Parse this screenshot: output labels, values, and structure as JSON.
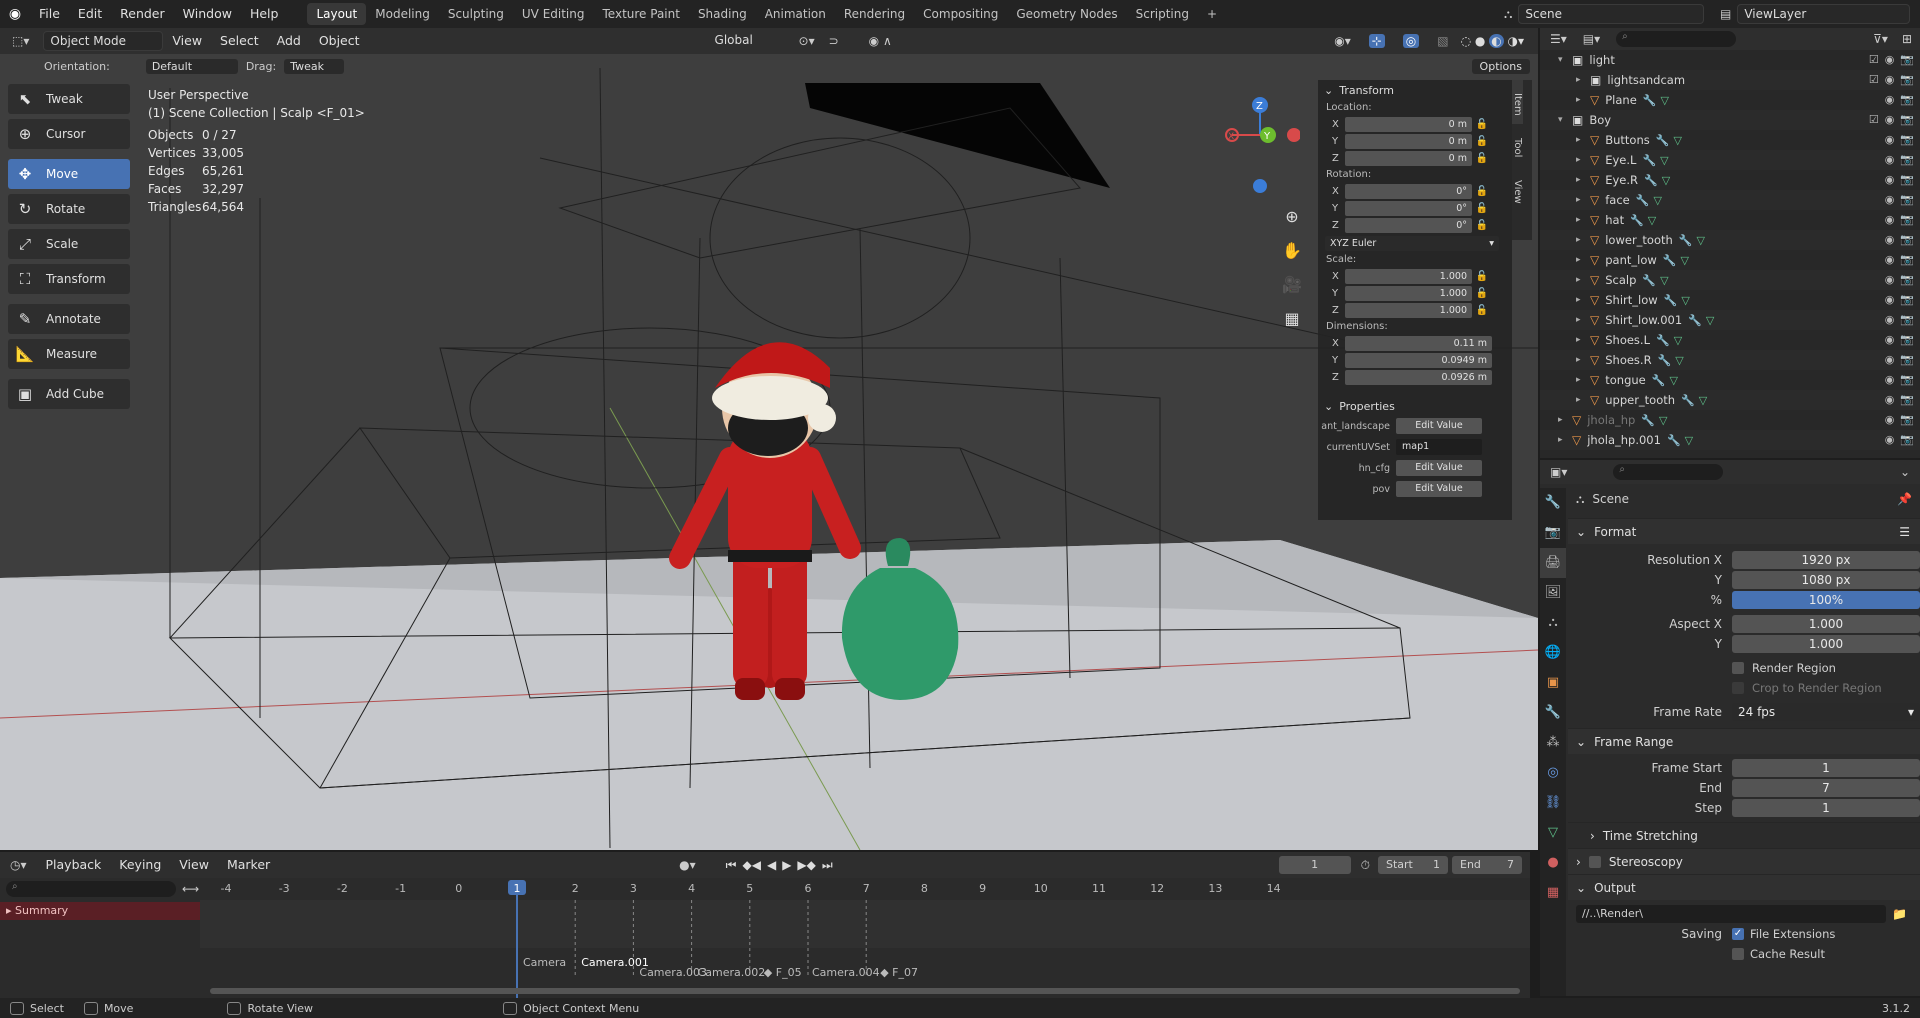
{
  "topbar": {
    "menus": [
      "File",
      "Edit",
      "Render",
      "Window",
      "Help"
    ],
    "workspaces": [
      "Layout",
      "Modeling",
      "Sculpting",
      "UV Editing",
      "Texture Paint",
      "Shading",
      "Animation",
      "Rendering",
      "Compositing",
      "Geometry Nodes",
      "Scripting"
    ],
    "active_workspace": "Layout",
    "add_tab": "+",
    "scene": "Scene",
    "view_layer": "ViewLayer"
  },
  "viewport": {
    "mode": "Object Mode",
    "menus": [
      "View",
      "Select",
      "Add",
      "Object"
    ],
    "transform_orientation": "Global",
    "orientation_label": "Orientation:",
    "orientation_value": "Default",
    "drag_label": "Drag:",
    "drag_value": "Tweak",
    "options_label": "Options",
    "perspective": "User Perspective",
    "collection_info": "(1) Scene Collection | Scalp <F_01>",
    "stats": [
      {
        "label": "Objects",
        "value": "0 / 27"
      },
      {
        "label": "Vertices",
        "value": "33,005"
      },
      {
        "label": "Edges",
        "value": "65,261"
      },
      {
        "label": "Faces",
        "value": "32,297"
      },
      {
        "label": "Triangles",
        "value": "64,564"
      }
    ],
    "gizmo": {
      "x": "X",
      "y": "Y",
      "z": "Z"
    }
  },
  "toolbar": {
    "tools": [
      {
        "label": "Tweak",
        "icon": "tweak-icon"
      },
      {
        "label": "Cursor",
        "icon": "cursor-icon"
      },
      {
        "label": "Move",
        "icon": "move-icon"
      },
      {
        "label": "Rotate",
        "icon": "rotate-icon"
      },
      {
        "label": "Scale",
        "icon": "scale-icon"
      },
      {
        "label": "Transform",
        "icon": "transform-icon"
      },
      {
        "label": "Annotate",
        "icon": "annotate-icon"
      },
      {
        "label": "Measure",
        "icon": "measure-icon"
      },
      {
        "label": "Add Cube",
        "icon": "add-cube-icon"
      }
    ],
    "active": "Move"
  },
  "npanel": {
    "tabs": [
      "Item",
      "Tool",
      "View"
    ],
    "transform_title": "Transform",
    "location_label": "Location:",
    "location": [
      {
        "axis": "X",
        "value": "0 m"
      },
      {
        "axis": "Y",
        "value": "0 m"
      },
      {
        "axis": "Z",
        "value": "0 m"
      }
    ],
    "rotation_label": "Rotation:",
    "rotation": [
      {
        "axis": "X",
        "value": "0°"
      },
      {
        "axis": "Y",
        "value": "0°"
      },
      {
        "axis": "Z",
        "value": "0°"
      }
    ],
    "rotation_mode": "XYZ Euler",
    "scale_label": "Scale:",
    "scale": [
      {
        "axis": "X",
        "value": "1.000"
      },
      {
        "axis": "Y",
        "value": "1.000"
      },
      {
        "axis": "Z",
        "value": "1.000"
      }
    ],
    "dimensions_label": "Dimensions:",
    "dimensions": [
      {
        "axis": "X",
        "value": "0.11 m"
      },
      {
        "axis": "Y",
        "value": "0.0949 m"
      },
      {
        "axis": "Z",
        "value": "0.0926 m"
      }
    ],
    "properties_title": "Properties",
    "properties": [
      {
        "key": "ant_landscape",
        "value": "Edit Value"
      },
      {
        "key": "currentUVSet",
        "value": "map1"
      },
      {
        "key": "hn_cfg",
        "value": "Edit Value"
      },
      {
        "key": "pov",
        "value": "Edit Value"
      }
    ]
  },
  "outliner": {
    "search_placeholder": "",
    "items": [
      {
        "name": "light",
        "type": "collection",
        "indent": 1
      },
      {
        "name": "lightsandcam",
        "type": "collection",
        "indent": 2
      },
      {
        "name": "Plane",
        "type": "object",
        "indent": 2
      },
      {
        "name": "Boy",
        "type": "collection",
        "indent": 1
      },
      {
        "name": "Buttons",
        "type": "object",
        "indent": 2
      },
      {
        "name": "Eye.L",
        "type": "object",
        "indent": 2
      },
      {
        "name": "Eye.R",
        "type": "object",
        "indent": 2
      },
      {
        "name": "face",
        "type": "object",
        "indent": 2
      },
      {
        "name": "hat",
        "type": "object",
        "indent": 2
      },
      {
        "name": "lower_tooth",
        "type": "object",
        "indent": 2
      },
      {
        "name": "pant_low",
        "type": "object",
        "indent": 2
      },
      {
        "name": "Scalp",
        "type": "object",
        "indent": 2
      },
      {
        "name": "Shirt_low",
        "type": "object",
        "indent": 2
      },
      {
        "name": "Shirt_low.001",
        "type": "object",
        "indent": 2
      },
      {
        "name": "Shoes.L",
        "type": "object",
        "indent": 2
      },
      {
        "name": "Shoes.R",
        "type": "object",
        "indent": 2
      },
      {
        "name": "tongue",
        "type": "object",
        "indent": 2
      },
      {
        "name": "upper_tooth",
        "type": "object",
        "indent": 2
      },
      {
        "name": "jhola_hp",
        "type": "object",
        "indent": 1
      },
      {
        "name": "jhola_hp.001",
        "type": "object",
        "indent": 1
      }
    ]
  },
  "properties": {
    "context": "Scene",
    "format_title": "Format",
    "resolution_x_label": "Resolution X",
    "resolution_x": "1920 px",
    "y_label": "Y",
    "resolution_y": "1080 px",
    "pct_label": "%",
    "resolution_pct": "100%",
    "aspect_x_label": "Aspect X",
    "aspect_x": "1.000",
    "aspect_y": "1.000",
    "render_region": "Render Region",
    "crop_to_render": "Crop to Render Region",
    "frame_rate_label": "Frame Rate",
    "frame_rate": "24 fps",
    "frame_range_title": "Frame Range",
    "frame_start_label": "Frame Start",
    "frame_start": "1",
    "end_label": "End",
    "frame_end": "7",
    "step_label": "Step",
    "frame_step": "1",
    "time_stretching": "Time Stretching",
    "stereoscopy": "Stereoscopy",
    "output_title": "Output",
    "output_path": "//..\\Render\\",
    "saving_label": "Saving",
    "file_extensions": "File Extensions",
    "cache_result": "Cache Result"
  },
  "timeline": {
    "menus": [
      "Playback",
      "Keying",
      "View",
      "Marker"
    ],
    "current_frame": "1",
    "start_label": "Start",
    "start": "1",
    "end_label": "End",
    "end": "7",
    "ruler": [
      "-4",
      "-3",
      "-2",
      "-1",
      "0",
      "1",
      "2",
      "3",
      "4",
      "5",
      "6",
      "7",
      "8",
      "9",
      "10",
      "11",
      "12",
      "13",
      "14"
    ],
    "summary": "Summary",
    "markers": [
      "Camera",
      "Camera.001",
      "Camera.003",
      "Camera.002",
      "F_05",
      "Camera.004",
      "F_07"
    ]
  },
  "statusbar": {
    "select": "Select",
    "move": "Move",
    "rotate_view": "Rotate View",
    "context_menu": "Object Context Menu",
    "version": "3.1.2"
  },
  "colors": {
    "accent": "#4772b3",
    "object_orange": "#e8954a",
    "modifier_blue": "#6a9ee8",
    "mesh_green": "#5fc08a"
  }
}
